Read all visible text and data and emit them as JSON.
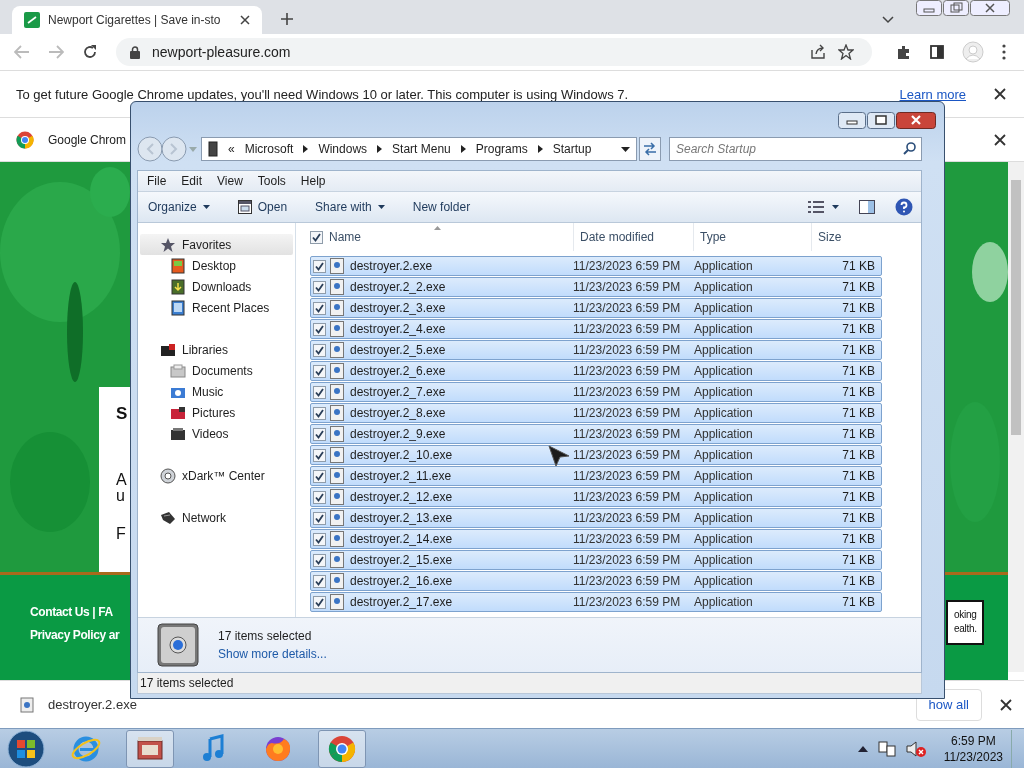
{
  "browser": {
    "tab": {
      "title": "Newport Cigarettes | Save in-sto",
      "selected": true
    },
    "address": "newport-pleasure.com",
    "infobar": {
      "text": "To get future Google Chrome updates, you'll need Windows 10 or later. This computer is using Windows 7.",
      "link": "Learn more"
    },
    "second_bar": {
      "text": "Google Chrom"
    },
    "page": {
      "card_letters": [
        "S",
        "A",
        "u",
        "F"
      ],
      "footer_links": [
        "Contact Us | FA",
        "Privacy Policy ar"
      ],
      "side_box": [
        "oking",
        "ealth."
      ]
    },
    "download": {
      "filename": "destroyer.2.exe",
      "show_all": "how all"
    }
  },
  "explorer": {
    "breadcrumb_overflow": "«",
    "breadcrumb": [
      "Microsoft",
      "Windows",
      "Start Menu",
      "Programs",
      "Startup"
    ],
    "search": {
      "placeholder": "Search Startup"
    },
    "menu": [
      "File",
      "Edit",
      "View",
      "Tools",
      "Help"
    ],
    "toolbar": [
      {
        "label": "Organize",
        "kind": "dropdown"
      },
      {
        "label": "Open",
        "kind": "open"
      },
      {
        "label": "Share with",
        "kind": "dropdown"
      },
      {
        "label": "New folder",
        "kind": "plain"
      }
    ],
    "nav": [
      {
        "label": "Favorites",
        "kind": "star",
        "selected": true,
        "children": [
          {
            "label": "Desktop",
            "kind": "desktop",
            "selected": false
          },
          {
            "label": "Downloads",
            "kind": "downloads",
            "selected": false
          },
          {
            "label": "Recent Places",
            "kind": "recent",
            "selected": false
          }
        ]
      },
      {
        "label": "Libraries",
        "kind": "library",
        "selected": false,
        "children": [
          {
            "label": "Documents",
            "kind": "documents",
            "selected": false
          },
          {
            "label": "Music",
            "kind": "music",
            "selected": false
          },
          {
            "label": "Pictures",
            "kind": "pictures",
            "selected": false
          },
          {
            "label": "Videos",
            "kind": "videos",
            "selected": false
          }
        ]
      },
      {
        "label": "xDark™ Center",
        "kind": "disc",
        "selected": false
      },
      {
        "label": "Network",
        "kind": "network",
        "selected": false
      }
    ],
    "columns": [
      "Name",
      "Date modified",
      "Type",
      "Size"
    ],
    "header_checked": true,
    "files": [
      {
        "name": "destroyer.2.exe",
        "date": "11/23/2023 6:59 PM",
        "type": "Application",
        "size": "71 KB",
        "selected": true,
        "checked": true
      },
      {
        "name": "destroyer.2_2.exe",
        "date": "11/23/2023 6:59 PM",
        "type": "Application",
        "size": "71 KB",
        "selected": true,
        "checked": true
      },
      {
        "name": "destroyer.2_3.exe",
        "date": "11/23/2023 6:59 PM",
        "type": "Application",
        "size": "71 KB",
        "selected": true,
        "checked": true
      },
      {
        "name": "destroyer.2_4.exe",
        "date": "11/23/2023 6:59 PM",
        "type": "Application",
        "size": "71 KB",
        "selected": true,
        "checked": true
      },
      {
        "name": "destroyer.2_5.exe",
        "date": "11/23/2023 6:59 PM",
        "type": "Application",
        "size": "71 KB",
        "selected": true,
        "checked": true
      },
      {
        "name": "destroyer.2_6.exe",
        "date": "11/23/2023 6:59 PM",
        "type": "Application",
        "size": "71 KB",
        "selected": true,
        "checked": true
      },
      {
        "name": "destroyer.2_7.exe",
        "date": "11/23/2023 6:59 PM",
        "type": "Application",
        "size": "71 KB",
        "selected": true,
        "checked": true
      },
      {
        "name": "destroyer.2_8.exe",
        "date": "11/23/2023 6:59 PM",
        "type": "Application",
        "size": "71 KB",
        "selected": true,
        "checked": true
      },
      {
        "name": "destroyer.2_9.exe",
        "date": "11/23/2023 6:59 PM",
        "type": "Application",
        "size": "71 KB",
        "selected": true,
        "checked": true
      },
      {
        "name": "destroyer.2_10.exe",
        "date": "11/23/2023 6:59 PM",
        "type": "Application",
        "size": "71 KB",
        "selected": true,
        "checked": true
      },
      {
        "name": "destroyer.2_11.exe",
        "date": "11/23/2023 6:59 PM",
        "type": "Application",
        "size": "71 KB",
        "selected": true,
        "checked": true
      },
      {
        "name": "destroyer.2_12.exe",
        "date": "11/23/2023 6:59 PM",
        "type": "Application",
        "size": "71 KB",
        "selected": true,
        "checked": true
      },
      {
        "name": "destroyer.2_13.exe",
        "date": "11/23/2023 6:59 PM",
        "type": "Application",
        "size": "71 KB",
        "selected": true,
        "checked": true
      },
      {
        "name": "destroyer.2_14.exe",
        "date": "11/23/2023 6:59 PM",
        "type": "Application",
        "size": "71 KB",
        "selected": true,
        "checked": true
      },
      {
        "name": "destroyer.2_15.exe",
        "date": "11/23/2023 6:59 PM",
        "type": "Application",
        "size": "71 KB",
        "selected": true,
        "checked": true
      },
      {
        "name": "destroyer.2_16.exe",
        "date": "11/23/2023 6:59 PM",
        "type": "Application",
        "size": "71 KB",
        "selected": true,
        "checked": true
      },
      {
        "name": "destroyer.2_17.exe",
        "date": "11/23/2023 6:59 PM",
        "type": "Application",
        "size": "71 KB",
        "selected": true,
        "checked": true
      }
    ],
    "details": {
      "count": "17 items selected",
      "link": "Show more details..."
    },
    "status": "17 items selected"
  },
  "taskbar": {
    "apps": [
      {
        "kind": "ie",
        "active": false
      },
      {
        "kind": "explorer",
        "active": true
      },
      {
        "kind": "music",
        "active": false
      },
      {
        "kind": "firefox",
        "active": false
      },
      {
        "kind": "chrome",
        "active": true
      }
    ],
    "time": "6:59 PM",
    "date": "11/23/2023"
  }
}
